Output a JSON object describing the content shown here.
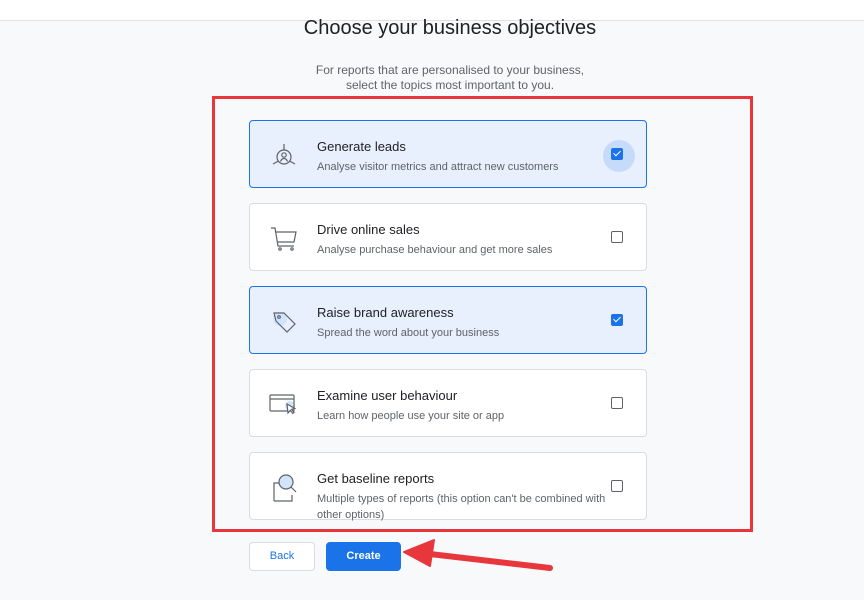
{
  "page": {
    "title": "Choose your business objectives",
    "subtitle_line1": "For reports that are personalised to your business,",
    "subtitle_line2": "select the topics most important to you."
  },
  "objectives": [
    {
      "name": "Generate leads",
      "description": "Analyse visitor metrics and attract new customers",
      "checked": true,
      "icon": "target-person-icon"
    },
    {
      "name": "Drive online sales",
      "description": "Analyse purchase behaviour and get more sales",
      "checked": false,
      "icon": "shopping-cart-icon"
    },
    {
      "name": "Raise brand awareness",
      "description": "Spread the word about your business",
      "checked": true,
      "icon": "tag-icon"
    },
    {
      "name": "Examine user behaviour",
      "description": "Learn how people use your site or app",
      "checked": false,
      "icon": "browser-cursor-icon"
    },
    {
      "name": "Get baseline reports",
      "description": "Multiple types of reports (this option can't be combined with other options)",
      "checked": false,
      "icon": "report-magnifier-icon"
    }
  ],
  "buttons": {
    "back": "Back",
    "create": "Create"
  },
  "colors": {
    "accent": "#1a73e8",
    "selected_bg": "#e8f0fe",
    "annotation_red": "#e8373c"
  }
}
